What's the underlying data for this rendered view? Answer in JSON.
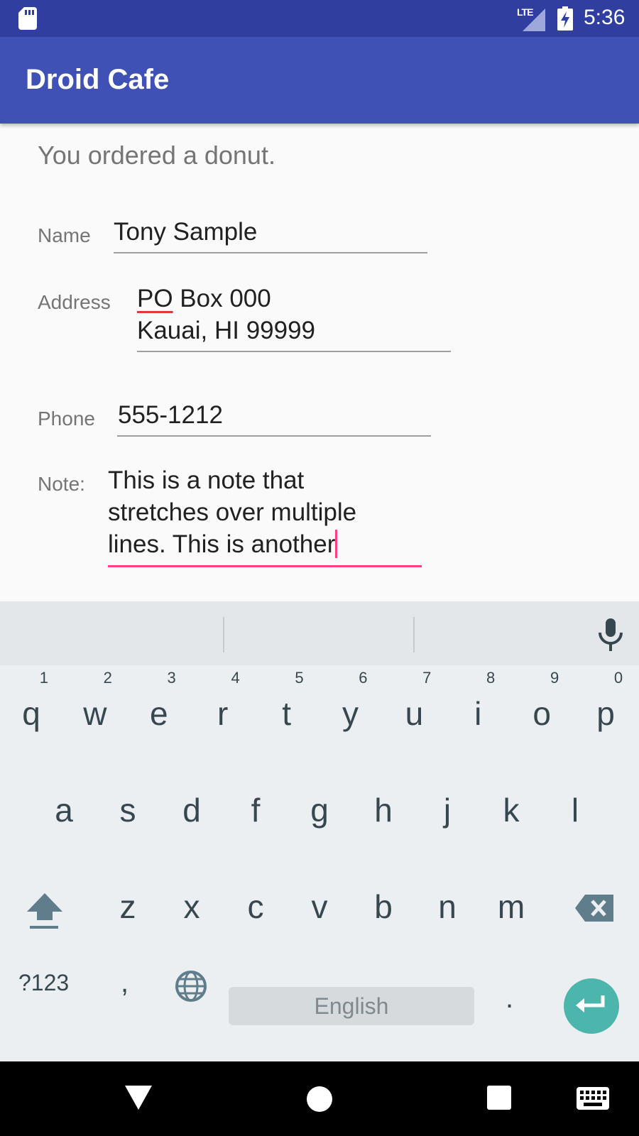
{
  "status_bar": {
    "time": "5:36",
    "network_label": "LTE",
    "icons": [
      "sd-card-icon",
      "lte-signal-icon",
      "battery-charging-icon"
    ]
  },
  "app_bar": {
    "title": "Droid Cafe",
    "color": "#3f51b5"
  },
  "order": {
    "message": "You ordered a donut."
  },
  "form": {
    "name": {
      "label": "Name",
      "value": "Tony Sample"
    },
    "address": {
      "label": "Address",
      "value_line1_misspelled": "PO",
      "value_line1_rest": " Box 000",
      "value_line2": "Kauai, HI 99999"
    },
    "phone": {
      "label": "Phone",
      "value": "555-1212"
    },
    "note": {
      "label": "Note:",
      "line1": "This is a note that",
      "line2": "stretches over multiple",
      "line3": "lines. This is another"
    }
  },
  "keyboard": {
    "row1": [
      {
        "key": "q",
        "hint": "1"
      },
      {
        "key": "w",
        "hint": "2"
      },
      {
        "key": "e",
        "hint": "3"
      },
      {
        "key": "r",
        "hint": "4"
      },
      {
        "key": "t",
        "hint": "5"
      },
      {
        "key": "y",
        "hint": "6"
      },
      {
        "key": "u",
        "hint": "7"
      },
      {
        "key": "i",
        "hint": "8"
      },
      {
        "key": "o",
        "hint": "9"
      },
      {
        "key": "p",
        "hint": "0"
      }
    ],
    "row2": [
      "a",
      "s",
      "d",
      "f",
      "g",
      "h",
      "j",
      "k",
      "l"
    ],
    "row3": [
      "z",
      "x",
      "c",
      "v",
      "b",
      "n",
      "m"
    ],
    "symbols_key": "?123",
    "comma_key": ",",
    "space_label": "English",
    "period_key": ".",
    "accent_color": "#4db6ac"
  },
  "nav_bar": {
    "icons": [
      "back-icon",
      "home-icon",
      "recents-icon",
      "keyboard-switch-icon"
    ]
  }
}
